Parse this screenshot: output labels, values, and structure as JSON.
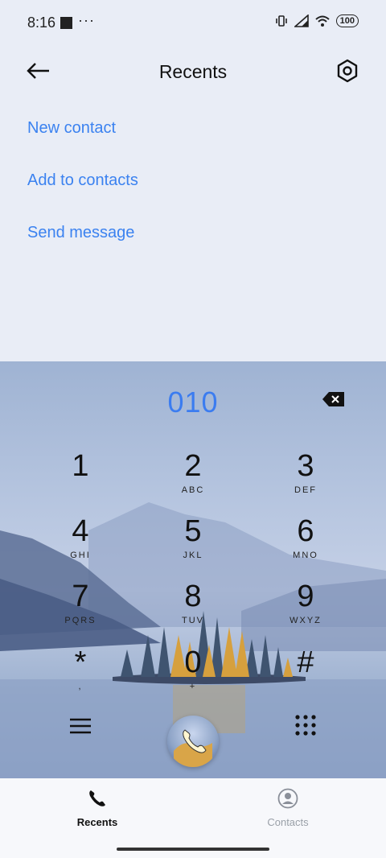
{
  "status_bar": {
    "time": "8:16",
    "dots": "···",
    "battery": "100"
  },
  "header": {
    "title": "Recents"
  },
  "actions": [
    {
      "label": "New contact"
    },
    {
      "label": "Add to contacts"
    },
    {
      "label": "Send message"
    }
  ],
  "dialer": {
    "input_value": "010",
    "keys": [
      {
        "digit": "1",
        "letters": ""
      },
      {
        "digit": "2",
        "letters": "ABC"
      },
      {
        "digit": "3",
        "letters": "DEF"
      },
      {
        "digit": "4",
        "letters": "GHI"
      },
      {
        "digit": "5",
        "letters": "JKL"
      },
      {
        "digit": "6",
        "letters": "MNO"
      },
      {
        "digit": "7",
        "letters": "PQRS"
      },
      {
        "digit": "8",
        "letters": "TUV"
      },
      {
        "digit": "9",
        "letters": "WXYZ"
      },
      {
        "digit": "*",
        "letters": ","
      },
      {
        "digit": "0",
        "letters": "+"
      },
      {
        "digit": "#",
        "letters": ""
      }
    ]
  },
  "bottom_nav": {
    "tabs": [
      {
        "label": "Recents",
        "active": true,
        "icon": "phone-icon"
      },
      {
        "label": "Contacts",
        "active": false,
        "icon": "person-circle-icon"
      }
    ]
  },
  "colors": {
    "accent": "#3b82f0",
    "background": "#e9edf6",
    "nav_bg": "#f7f8fb"
  }
}
